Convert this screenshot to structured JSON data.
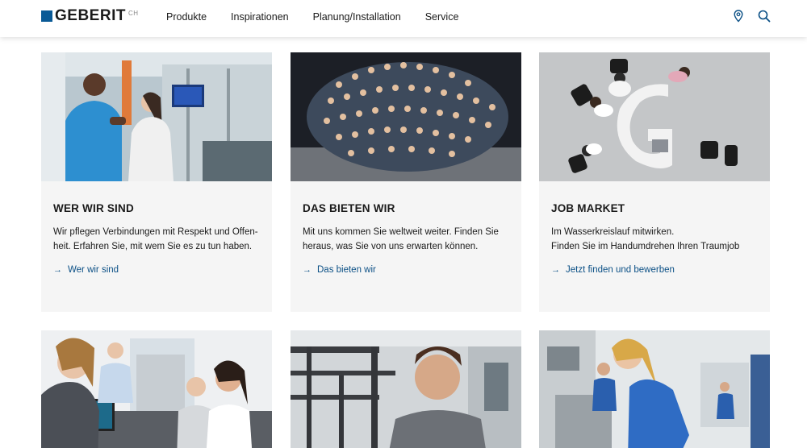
{
  "header": {
    "logo_text": "GEBERIT",
    "logo_country": "CH",
    "nav": [
      "Produkte",
      "Inspirationen",
      "Planung/Installation",
      "Service"
    ],
    "icons": [
      "location-pin-icon",
      "search-icon"
    ]
  },
  "cards": [
    {
      "title": "WER WIR SIND",
      "text": "Wir pflegen Verbindungen mit Respekt und Offen-\nheit. Erfahren Sie, mit wem Sie es zu tun haben.",
      "link": "Wer wir sind"
    },
    {
      "title": "DAS BIETEN WIR",
      "text": "Mit uns kommen Sie weltweit weiter. Finden Sie\nheraus, was Sie von uns erwarten können.",
      "link": "Das bieten wir"
    },
    {
      "title": "JOB MARKET",
      "text": "Im Wasserkreislauf mitwirken.\nFinden Sie im Handumdrehen Ihren Traumjob",
      "link": "Jetzt finden und bewerben"
    }
  ],
  "colors": {
    "brand_blue": "#0a5a96",
    "link_blue": "#0a4f85",
    "card_bg": "#f5f5f5"
  }
}
